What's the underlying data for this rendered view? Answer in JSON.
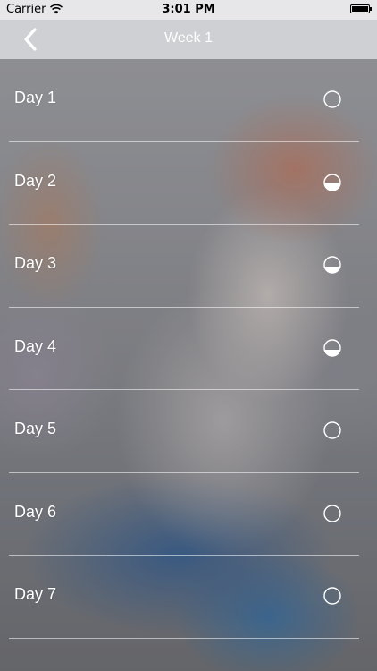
{
  "status_bar": {
    "carrier": "Carrier",
    "time": "3:01 PM"
  },
  "nav": {
    "title": "Week 1",
    "back_icon": "chevron-left-icon"
  },
  "days": [
    {
      "label": "Day 1",
      "progress": 0
    },
    {
      "label": "Day 2",
      "progress": 0.5
    },
    {
      "label": "Day 3",
      "progress": 0.4
    },
    {
      "label": "Day 4",
      "progress": 0.4
    },
    {
      "label": "Day 5",
      "progress": 0
    },
    {
      "label": "Day 6",
      "progress": 0
    },
    {
      "label": "Day 7",
      "progress": 0
    }
  ],
  "colors": {
    "text": "#ffffff",
    "status_bar_bg": "#e7e7e9",
    "nav_bar_bg": "#cfd0d3"
  }
}
